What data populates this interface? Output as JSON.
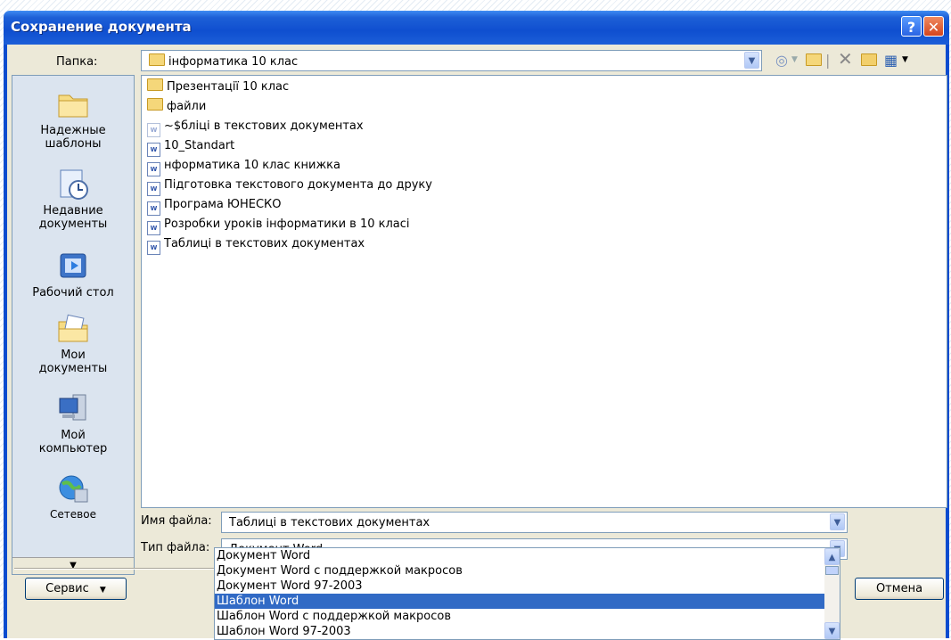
{
  "dialog": {
    "title": "Сохранение документа",
    "help_button": "?",
    "close_button": "✕"
  },
  "folder": {
    "label": "Папка:",
    "value": "інформатика 10 клас"
  },
  "places": [
    {
      "label_line1": "Надежные",
      "label_line2": "шаблоны",
      "icon": "folder-icon"
    },
    {
      "label_line1": "Недавние",
      "label_line2": "документы",
      "icon": "recent-documents-icon"
    },
    {
      "label_line1": "Рабочий стол",
      "label_line2": "",
      "icon": "desktop-icon"
    },
    {
      "label_line1": "Мои",
      "label_line2": "документы",
      "icon": "my-documents-icon"
    },
    {
      "label_line1": "Мой",
      "label_line2": "компьютер",
      "icon": "my-computer-icon"
    },
    {
      "label_line1": "Сетевое",
      "label_line2": "",
      "icon": "network-icon"
    }
  ],
  "files": [
    {
      "name": "Презентації 10 клас",
      "type": "folder"
    },
    {
      "name": "файли",
      "type": "folder"
    },
    {
      "name": "~$бліці в текстових документах",
      "type": "doc-faint"
    },
    {
      "name": "10_Standart",
      "type": "doc"
    },
    {
      "name": "нформатика 10 клас книжка",
      "type": "doc"
    },
    {
      "name": "Підготовка текстового документа до друку",
      "type": "doc"
    },
    {
      "name": "Програма ЮНЕСКО",
      "type": "doc"
    },
    {
      "name": "Розробки уроків інформатики в 10 класі",
      "type": "doc"
    },
    {
      "name": "Таблиці в текстових документах",
      "type": "doc"
    }
  ],
  "filename": {
    "label": "Имя файла:",
    "value": "Таблиці в текстових документах"
  },
  "filetype": {
    "label": "Тип файла:",
    "value": "Документ Word",
    "options": [
      "Документ Word",
      "Документ Word с поддержкой макросов",
      "Документ Word 97-2003",
      "Шаблон Word",
      "Шаблон Word с поддержкой макросов",
      "Шаблон Word 97-2003"
    ],
    "selected_index": 3
  },
  "buttons": {
    "service": "Сервис",
    "cancel": "Отмена"
  },
  "colors": {
    "titlebar": "#0f4fd0",
    "selection": "#316ac5",
    "dialog_bg": "#ece9d8"
  }
}
